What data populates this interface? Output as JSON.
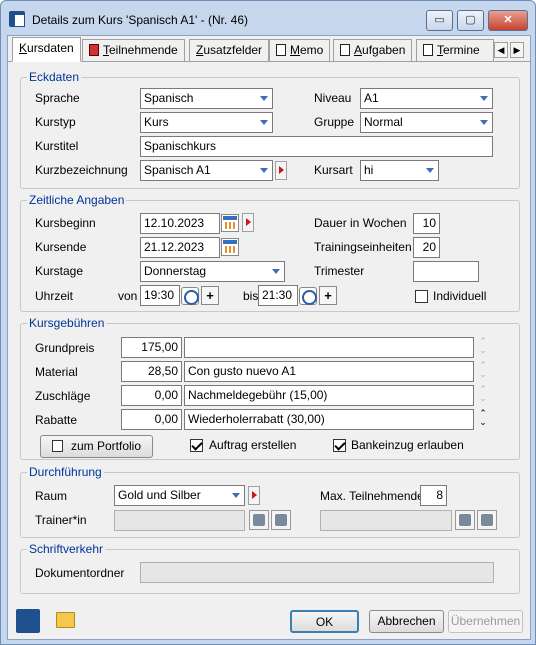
{
  "window": {
    "title": "Details zum Kurs 'Spanisch A1' - (Nr. 46)",
    "minimize": "▭",
    "restore": "▢",
    "close": "✕"
  },
  "tabs": [
    {
      "label": "Kursdaten",
      "mnemonic": "K",
      "rest": "ursdaten"
    },
    {
      "label": "Teilnehmende",
      "mnemonic": "T",
      "rest": "eilnehmende"
    },
    {
      "label": "Zusatzfelder",
      "mnemonic": "Z",
      "rest": "usatzfelder"
    },
    {
      "label": "Memo",
      "mnemonic": "M",
      "rest": "emo"
    },
    {
      "label": "Aufgaben",
      "mnemonic": "A",
      "rest": "ufgaben"
    },
    {
      "label": "Termine",
      "mnemonic": "T",
      "rest": "ermine"
    }
  ],
  "tabnav": {
    "prev": "◀",
    "next": "▶"
  },
  "eckdaten": {
    "legend": "Eckdaten",
    "sprache_label": "Sprache",
    "sprache_value": "Spanisch",
    "niveau_label": "Niveau",
    "niveau_value": "A1",
    "kurstyp_label": "Kurstyp",
    "kurstyp_value": "Kurs",
    "gruppe_label": "Gruppe",
    "gruppe_value": "Normal",
    "kurstitel_label": "Kurstitel",
    "kurstitel_value": "Spanischkurs",
    "kurzbez_label": "Kurzbezeichnung",
    "kurzbez_value": "Spanisch A1",
    "kursart_label": "Kursart",
    "kursart_value": "hi"
  },
  "zeitlich": {
    "legend": "Zeitliche Angaben",
    "beginn_label": "Kursbeginn",
    "beginn_value": "12.10.2023",
    "ende_label": "Kursende",
    "ende_value": "21.12.2023",
    "tage_label": "Kurstage",
    "tage_value": "Donnerstag",
    "uhrzeit_label": "Uhrzeit",
    "von_label": "von",
    "von_value": "19:30",
    "bis_label": "bis",
    "bis_value": "21:30",
    "dauer_label": "Dauer in Wochen",
    "dauer_value": "10",
    "training_label": "Trainingseinheiten",
    "training_value": "20",
    "trimester_label": "Trimester",
    "trimester_value": "",
    "individuell_label": "Individuell",
    "plus": "+"
  },
  "gebuehren": {
    "legend": "Kursgebühren",
    "rows": [
      {
        "label": "Grundpreis",
        "amount": "175,00",
        "text": ""
      },
      {
        "label": "Material",
        "amount": "28,50",
        "text": "Con gusto nuevo A1"
      },
      {
        "label": "Zuschläge",
        "amount": "0,00",
        "text": "Nachmeldegebühr (15,00)"
      },
      {
        "label": "Rabatte",
        "amount": "0,00",
        "text": "Wiederholerrabatt (30,00)"
      }
    ],
    "portfolio_button": "zum Portfolio",
    "auftrag_label": "Auftrag erstellen",
    "bankeinzug_label": "Bankeinzug erlauben",
    "spin_up": "⌃",
    "spin_down": "⌄"
  },
  "durchfuehrung": {
    "legend": "Durchführung",
    "raum_label": "Raum",
    "raum_value": "Gold und Silber",
    "max_label": "Max. Teilnehmende",
    "max_value": "8",
    "trainer_label": "Trainer*in"
  },
  "schriftverkehr": {
    "legend": "Schriftverkehr",
    "ordner_label": "Dokumentordner"
  },
  "footer": {
    "ok": "OK",
    "abbrechen": "Abbrechen",
    "uebernehmen": "Übernehmen"
  }
}
